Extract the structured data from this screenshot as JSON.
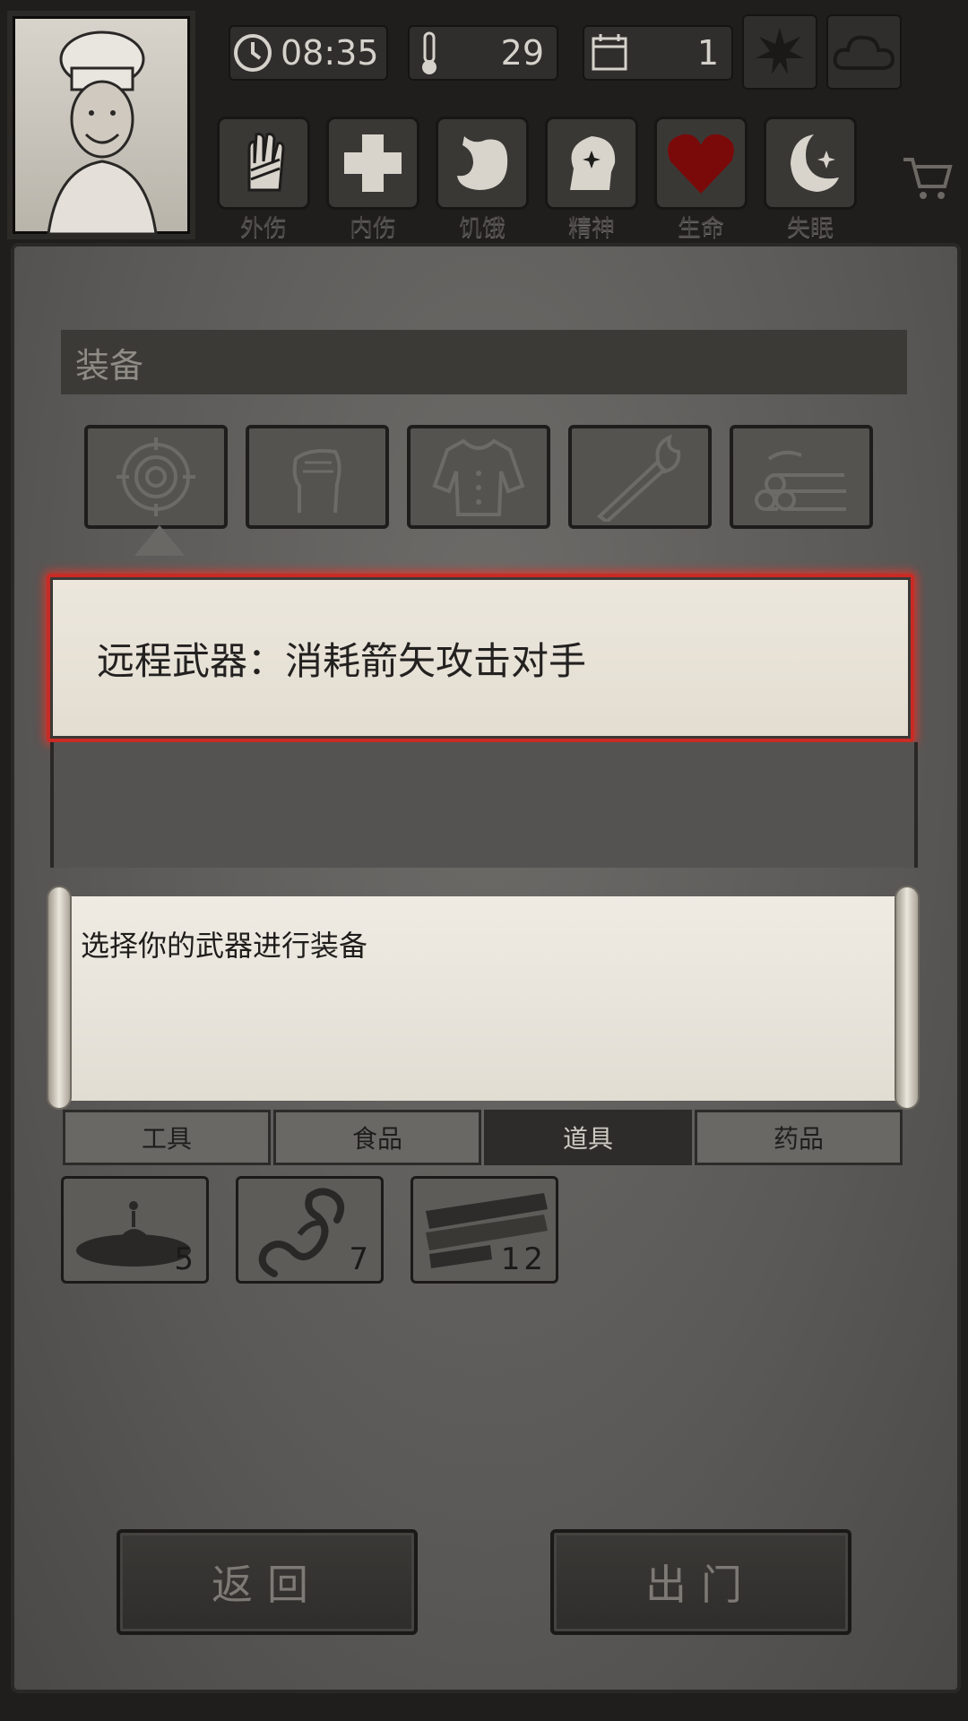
{
  "hud": {
    "time": "08:35",
    "temperature": "29",
    "day": "1",
    "season_icon": "leaf-icon",
    "weather_icon": "cloud-icon"
  },
  "status": [
    {
      "label": "外伤",
      "icon": "hand-icon"
    },
    {
      "label": "内伤",
      "icon": "cross-icon"
    },
    {
      "label": "饥饿",
      "icon": "stomach-icon"
    },
    {
      "label": "精神",
      "icon": "head-sparkle-icon"
    },
    {
      "label": "生命",
      "icon": "heart-icon"
    },
    {
      "label": "失眠",
      "icon": "moon-star-icon"
    }
  ],
  "equipment": {
    "header": "装备",
    "slots": [
      "target-icon",
      "fist-icon",
      "shirt-icon",
      "torch-icon",
      "firewood-icon"
    ]
  },
  "tooltip": {
    "text": "远程武器：消耗箭矢攻击对手"
  },
  "scroll": {
    "text": "选择你的武器进行装备"
  },
  "tabs": [
    {
      "label": "工具",
      "active": false
    },
    {
      "label": "食品",
      "active": false
    },
    {
      "label": "道具",
      "active": true
    },
    {
      "label": "药品",
      "active": false
    }
  ],
  "items": [
    {
      "icon": "tar-puddle-icon",
      "count": "5"
    },
    {
      "icon": "rope-icon",
      "count": "7"
    },
    {
      "icon": "planks-icon",
      "count": "12"
    }
  ],
  "buttons": {
    "back": "返回",
    "go_out": "出门"
  },
  "colors": {
    "tooltip_border": "#c92b25",
    "heart": "#7a0a0a"
  }
}
